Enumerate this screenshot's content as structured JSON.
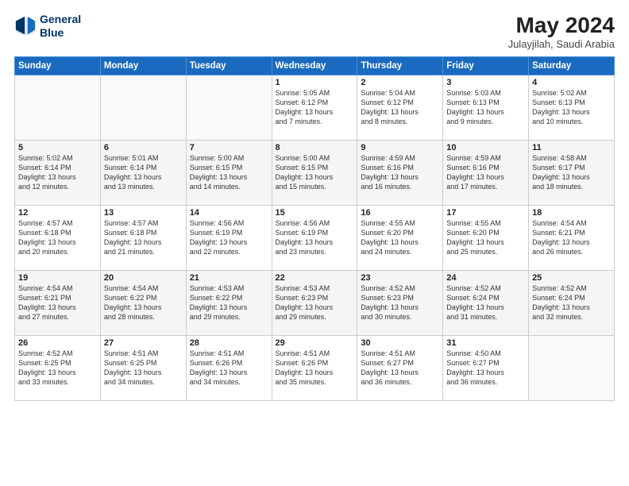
{
  "header": {
    "logo_line1": "General",
    "logo_line2": "Blue",
    "title": "May 2024",
    "location": "Julayjilah, Saudi Arabia"
  },
  "days_of_week": [
    "Sunday",
    "Monday",
    "Tuesday",
    "Wednesday",
    "Thursday",
    "Friday",
    "Saturday"
  ],
  "weeks": [
    [
      {
        "day": "",
        "text": ""
      },
      {
        "day": "",
        "text": ""
      },
      {
        "day": "",
        "text": ""
      },
      {
        "day": "1",
        "text": "Sunrise: 5:05 AM\nSunset: 6:12 PM\nDaylight: 13 hours\nand 7 minutes."
      },
      {
        "day": "2",
        "text": "Sunrise: 5:04 AM\nSunset: 6:12 PM\nDaylight: 13 hours\nand 8 minutes."
      },
      {
        "day": "3",
        "text": "Sunrise: 5:03 AM\nSunset: 6:13 PM\nDaylight: 13 hours\nand 9 minutes."
      },
      {
        "day": "4",
        "text": "Sunrise: 5:02 AM\nSunset: 6:13 PM\nDaylight: 13 hours\nand 10 minutes."
      }
    ],
    [
      {
        "day": "5",
        "text": "Sunrise: 5:02 AM\nSunset: 6:14 PM\nDaylight: 13 hours\nand 12 minutes."
      },
      {
        "day": "6",
        "text": "Sunrise: 5:01 AM\nSunset: 6:14 PM\nDaylight: 13 hours\nand 13 minutes."
      },
      {
        "day": "7",
        "text": "Sunrise: 5:00 AM\nSunset: 6:15 PM\nDaylight: 13 hours\nand 14 minutes."
      },
      {
        "day": "8",
        "text": "Sunrise: 5:00 AM\nSunset: 6:15 PM\nDaylight: 13 hours\nand 15 minutes."
      },
      {
        "day": "9",
        "text": "Sunrise: 4:59 AM\nSunset: 6:16 PM\nDaylight: 13 hours\nand 16 minutes."
      },
      {
        "day": "10",
        "text": "Sunrise: 4:59 AM\nSunset: 6:16 PM\nDaylight: 13 hours\nand 17 minutes."
      },
      {
        "day": "11",
        "text": "Sunrise: 4:58 AM\nSunset: 6:17 PM\nDaylight: 13 hours\nand 18 minutes."
      }
    ],
    [
      {
        "day": "12",
        "text": "Sunrise: 4:57 AM\nSunset: 6:18 PM\nDaylight: 13 hours\nand 20 minutes."
      },
      {
        "day": "13",
        "text": "Sunrise: 4:57 AM\nSunset: 6:18 PM\nDaylight: 13 hours\nand 21 minutes."
      },
      {
        "day": "14",
        "text": "Sunrise: 4:56 AM\nSunset: 6:19 PM\nDaylight: 13 hours\nand 22 minutes."
      },
      {
        "day": "15",
        "text": "Sunrise: 4:56 AM\nSunset: 6:19 PM\nDaylight: 13 hours\nand 23 minutes."
      },
      {
        "day": "16",
        "text": "Sunrise: 4:55 AM\nSunset: 6:20 PM\nDaylight: 13 hours\nand 24 minutes."
      },
      {
        "day": "17",
        "text": "Sunrise: 4:55 AM\nSunset: 6:20 PM\nDaylight: 13 hours\nand 25 minutes."
      },
      {
        "day": "18",
        "text": "Sunrise: 4:54 AM\nSunset: 6:21 PM\nDaylight: 13 hours\nand 26 minutes."
      }
    ],
    [
      {
        "day": "19",
        "text": "Sunrise: 4:54 AM\nSunset: 6:21 PM\nDaylight: 13 hours\nand 27 minutes."
      },
      {
        "day": "20",
        "text": "Sunrise: 4:54 AM\nSunset: 6:22 PM\nDaylight: 13 hours\nand 28 minutes."
      },
      {
        "day": "21",
        "text": "Sunrise: 4:53 AM\nSunset: 6:22 PM\nDaylight: 13 hours\nand 29 minutes."
      },
      {
        "day": "22",
        "text": "Sunrise: 4:53 AM\nSunset: 6:23 PM\nDaylight: 13 hours\nand 29 minutes."
      },
      {
        "day": "23",
        "text": "Sunrise: 4:52 AM\nSunset: 6:23 PM\nDaylight: 13 hours\nand 30 minutes."
      },
      {
        "day": "24",
        "text": "Sunrise: 4:52 AM\nSunset: 6:24 PM\nDaylight: 13 hours\nand 31 minutes."
      },
      {
        "day": "25",
        "text": "Sunrise: 4:52 AM\nSunset: 6:24 PM\nDaylight: 13 hours\nand 32 minutes."
      }
    ],
    [
      {
        "day": "26",
        "text": "Sunrise: 4:52 AM\nSunset: 6:25 PM\nDaylight: 13 hours\nand 33 minutes."
      },
      {
        "day": "27",
        "text": "Sunrise: 4:51 AM\nSunset: 6:25 PM\nDaylight: 13 hours\nand 34 minutes."
      },
      {
        "day": "28",
        "text": "Sunrise: 4:51 AM\nSunset: 6:26 PM\nDaylight: 13 hours\nand 34 minutes."
      },
      {
        "day": "29",
        "text": "Sunrise: 4:51 AM\nSunset: 6:26 PM\nDaylight: 13 hours\nand 35 minutes."
      },
      {
        "day": "30",
        "text": "Sunrise: 4:51 AM\nSunset: 6:27 PM\nDaylight: 13 hours\nand 36 minutes."
      },
      {
        "day": "31",
        "text": "Sunrise: 4:50 AM\nSunset: 6:27 PM\nDaylight: 13 hours\nand 36 minutes."
      },
      {
        "day": "",
        "text": ""
      }
    ]
  ]
}
